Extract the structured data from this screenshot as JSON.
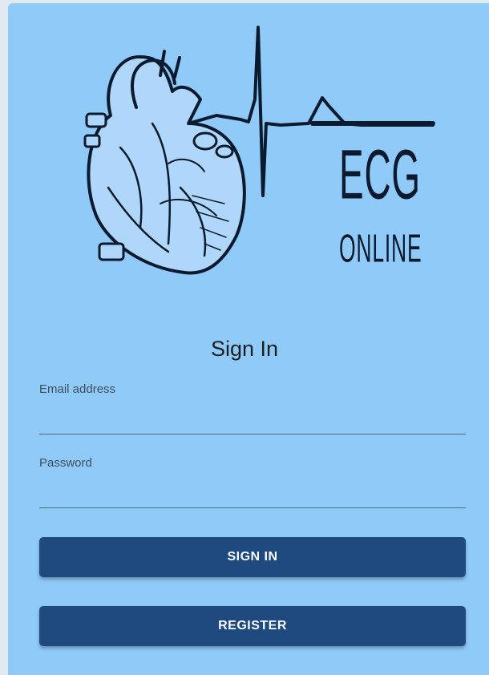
{
  "logo": {
    "line1": "ECG",
    "line2": "ONLINE",
    "image": "anatomical-heart-with-ecg-wave-icon",
    "color": "#0b1a2e"
  },
  "form": {
    "title": "Sign In",
    "email": {
      "label": "Email address",
      "value": ""
    },
    "password": {
      "label": "Password",
      "value": ""
    },
    "signin_label": "SIGN IN",
    "register_label": "REGISTER"
  },
  "colors": {
    "background": "#90caf9",
    "button": "#1e4a80",
    "button_text": "#ffffff"
  }
}
